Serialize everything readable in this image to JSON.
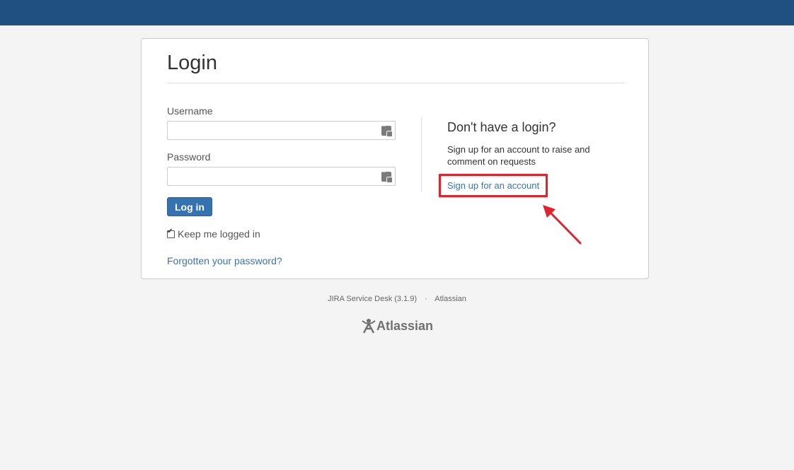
{
  "header": {
    "bar_color": "#205081"
  },
  "login": {
    "title": "Login",
    "username_label": "Username",
    "username_value": "",
    "password_label": "Password",
    "password_value": "",
    "submit_label": "Log in",
    "remember_label": "Keep me logged in",
    "remember_checked": true,
    "forgot_label": "Forgotten your password?"
  },
  "signup": {
    "heading": "Don't have a login?",
    "description": "Sign up for an account to raise and comment on requests",
    "link_label": "Sign up for an account",
    "highlight_color": "#e0242f"
  },
  "footer": {
    "product": "JIRA Service Desk (3.1.9)",
    "separator": "·",
    "company": "Atlassian",
    "logo_text": "Atlassian"
  },
  "icons": {
    "password_manager": "password-manager-icon",
    "arrow": "annotation-arrow-icon"
  }
}
